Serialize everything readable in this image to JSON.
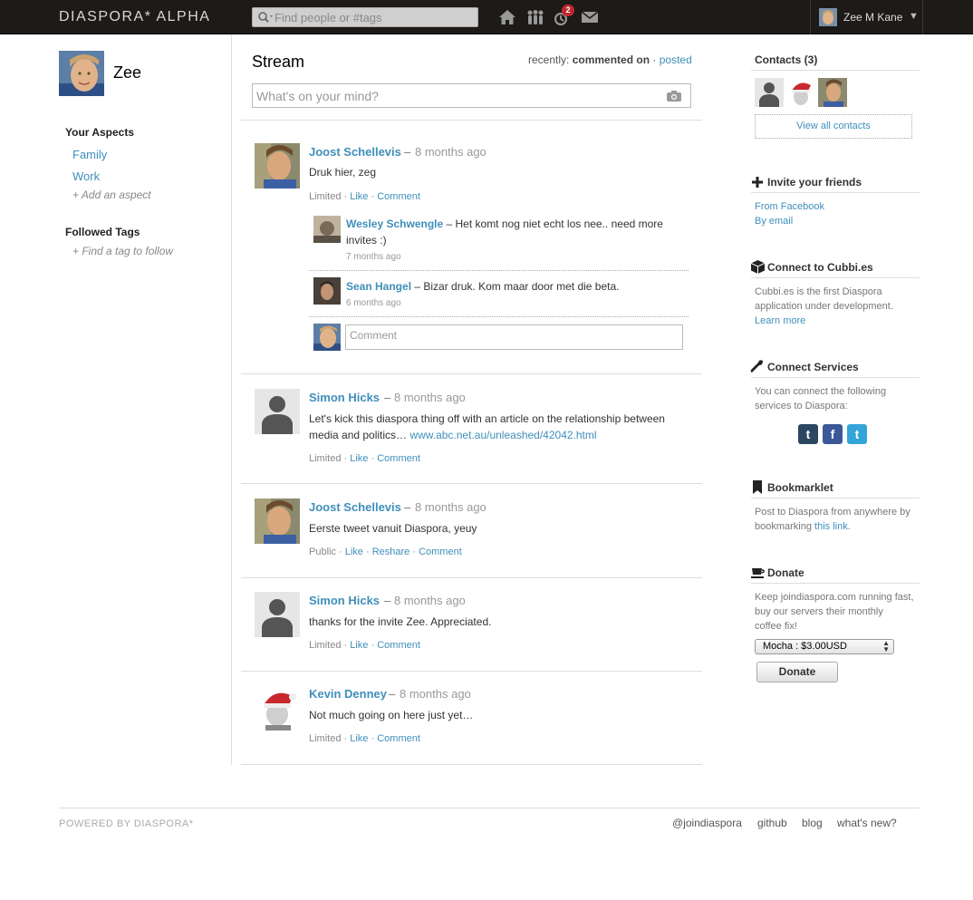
{
  "header": {
    "brand": "DIASPORA* ALPHA",
    "search_placeholder": "Find people or #tags",
    "notification_count": "2",
    "user_name": "Zee M Kane",
    "caret": "▼"
  },
  "left": {
    "profile_name": "Zee",
    "aspects_title": "Your Aspects",
    "aspects": [
      "Family",
      "Work"
    ],
    "add_aspect": "+ Add an aspect",
    "tags_title": "Followed Tags",
    "add_tag": "+ Find a tag to follow"
  },
  "stream": {
    "title": "Stream",
    "sort_prefix": "recently:",
    "sort_active": "commented on",
    "sort_sep": "·",
    "sort_other": "posted",
    "publisher_placeholder": "What's on your mind?",
    "posts": [
      {
        "author": "Joost Schellevis",
        "time": "8 months ago",
        "text": "Druk hier, zeg",
        "visibility": "Limited",
        "actions": [
          "Like",
          "Comment"
        ],
        "comments": [
          {
            "author": "Wesley Schwengle",
            "text_line1": "– Het komt nog niet echt los nee.. need more",
            "text_line2": "invites :)",
            "time": "7 months ago"
          },
          {
            "author": "Sean Hangel",
            "text_line1": "– Bizar druk. Kom maar door met die beta.",
            "time": "6 months ago"
          }
        ],
        "comment_placeholder": "Comment"
      },
      {
        "author": "Simon Hicks",
        "time": "8 months ago",
        "text_line1": "Let's kick this diaspora thing off with an article on the relationship between",
        "text_line2": "media and politics…",
        "link": "www.abc.net.au/unleashed/42042.html",
        "visibility": "Limited",
        "actions": [
          "Like",
          "Comment"
        ]
      },
      {
        "author": "Joost Schellevis",
        "time": "8 months ago",
        "text": "Eerste tweet vanuit Diaspora, yeuy",
        "visibility": "Public",
        "actions": [
          "Like",
          "Reshare",
          "Comment"
        ]
      },
      {
        "author": "Simon Hicks",
        "time": "8 months ago",
        "text": "thanks for the invite Zee. Appreciated.",
        "visibility": "Limited",
        "actions": [
          "Like",
          "Comment"
        ]
      },
      {
        "author": "Kevin Denney",
        "time": "8 months ago",
        "text": "Not much going on here just yet…",
        "visibility": "Limited",
        "actions": [
          "Like",
          "Comment"
        ]
      }
    ]
  },
  "right": {
    "contacts_title": "Contacts (3)",
    "view_all": "View all contacts",
    "invite_title": "Invite your friends",
    "invite_links": [
      "From Facebook",
      "By email"
    ],
    "cubbies_title": "Connect to Cubbi.es",
    "cubbies_text_line1": "Cubbi.es is the first Diaspora",
    "cubbies_text_line2": "application under development.",
    "cubbies_link": "Learn more",
    "services_title": "Connect Services",
    "services_text_line1": "You can connect the following",
    "services_text_line2": "services to Diaspora:",
    "services": [
      {
        "name": "tumblr",
        "glyph": "t",
        "color": "#2c4762"
      },
      {
        "name": "facebook",
        "glyph": "f",
        "color": "#3b5998"
      },
      {
        "name": "twitter",
        "glyph": "t",
        "color": "#33a5d8"
      }
    ],
    "bookmarklet_title": "Bookmarklet",
    "bookmarklet_text_line1": "Post to Diaspora from anywhere by",
    "bookmarklet_text_line2": "bookmarking",
    "bookmarklet_link": "this link.",
    "donate_title": "Donate",
    "donate_text_line1": "Keep joindiaspora.com running fast,",
    "donate_text_line2": "buy our servers their monthly",
    "donate_text_line3": "coffee fix!",
    "donate_option": "Mocha : $3.00USD",
    "donate_button": "Donate"
  },
  "footer": {
    "powered": "POWERED BY DIASPORA*",
    "links": [
      "@joindiaspora",
      "github",
      "blog",
      "what's new?"
    ]
  },
  "colors": {
    "link": "#3f8fba",
    "header_bg": "#1d1a18",
    "badge": "#c1272d"
  }
}
